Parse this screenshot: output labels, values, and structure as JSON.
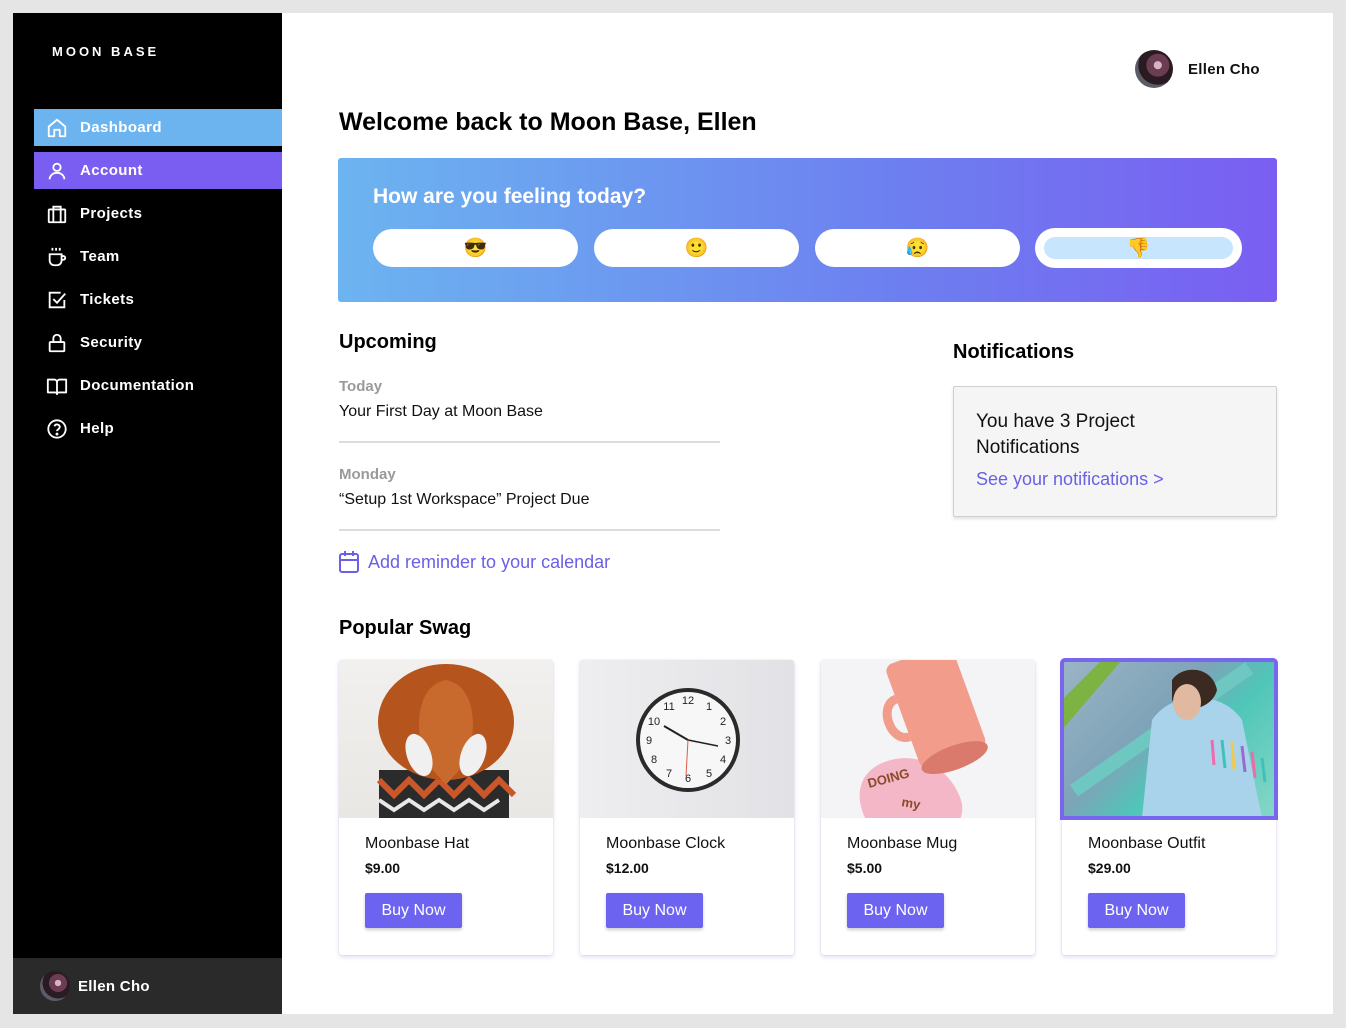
{
  "brand": "MOON BASE",
  "nav": [
    {
      "label": "Dashboard",
      "icon": "home-icon",
      "state": "active"
    },
    {
      "label": "Account",
      "icon": "user-icon",
      "state": "hover"
    },
    {
      "label": "Projects",
      "icon": "briefcase-icon",
      "state": "normal"
    },
    {
      "label": "Team",
      "icon": "coffee-icon",
      "state": "normal"
    },
    {
      "label": "Tickets",
      "icon": "checkbox-icon",
      "state": "normal"
    },
    {
      "label": "Security",
      "icon": "lock-icon",
      "state": "normal"
    },
    {
      "label": "Documentation",
      "icon": "book-icon",
      "state": "normal"
    },
    {
      "label": "Help",
      "icon": "help-circle-icon",
      "state": "normal"
    }
  ],
  "colors": {
    "nav_active": "#6cb4f0",
    "nav_hover": "#7a5ef2",
    "accent": "#6c63f0",
    "link": "#6a5fe6"
  },
  "user": {
    "name": "Ellen Cho"
  },
  "page_title": "Welcome back to Moon Base, Ellen",
  "feeling": {
    "title": "How are you feeling today?",
    "options": [
      {
        "emoji": "😎",
        "name": "cool"
      },
      {
        "emoji": "🙂",
        "name": "happy"
      },
      {
        "emoji": "😥",
        "name": "sad"
      },
      {
        "emoji": "👎",
        "name": "thumbs-down",
        "selected": true
      }
    ]
  },
  "upcoming": {
    "heading": "Upcoming",
    "events": [
      {
        "day": "Today",
        "title": "Your First Day at Moon Base"
      },
      {
        "day": "Monday",
        "title": "“Setup 1st Workspace” Project Due"
      }
    ],
    "add_reminder": "Add reminder to your calendar"
  },
  "notifications": {
    "heading": "Notifications",
    "message": "You have 3 Project Notifications",
    "link": "See your notifications >"
  },
  "swag": {
    "heading": "Popular Swag",
    "items": [
      {
        "name": "Moonbase Hat",
        "price": "$9.00",
        "button": "Buy Now"
      },
      {
        "name": "Moonbase Clock",
        "price": "$12.00",
        "button": "Buy Now"
      },
      {
        "name": "Moonbase Mug",
        "price": "$5.00",
        "button": "Buy Now"
      },
      {
        "name": "Moonbase Outfit",
        "price": "$29.00",
        "button": "Buy Now",
        "highlighted": true
      }
    ]
  }
}
